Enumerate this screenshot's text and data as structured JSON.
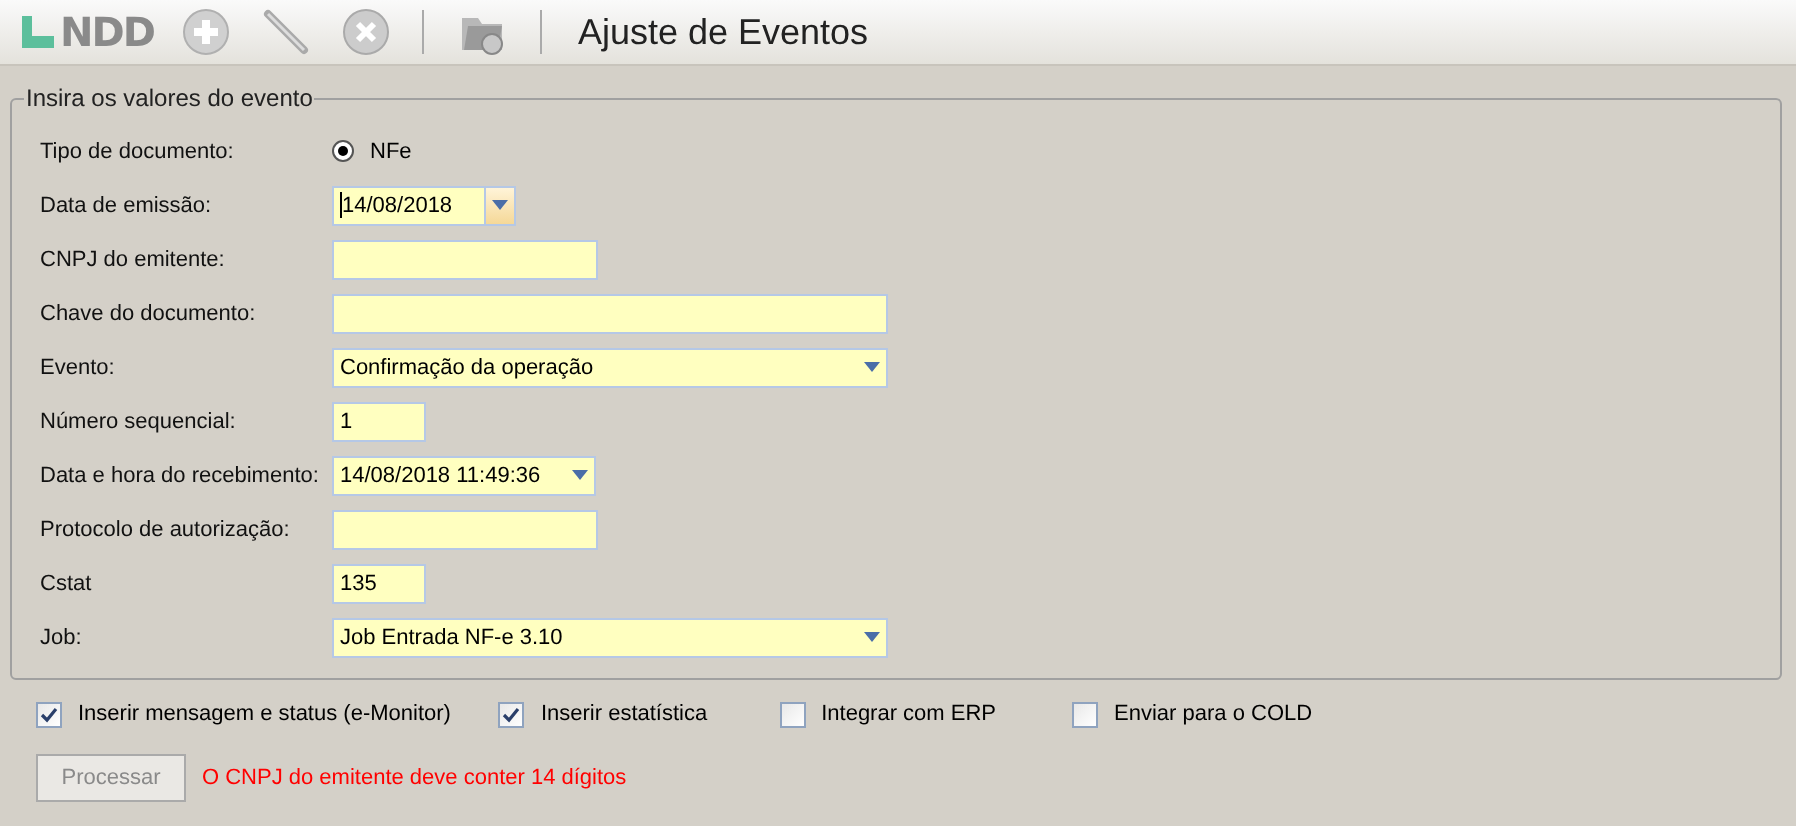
{
  "toolbar": {
    "logo": "NDD",
    "title": "Ajuste de Eventos",
    "tools": [
      {
        "kind": "add",
        "disabled": true
      },
      {
        "kind": "edit",
        "disabled": true
      },
      {
        "kind": "delete",
        "disabled": true
      },
      {
        "kind": "folder",
        "disabled": true
      }
    ]
  },
  "group": {
    "title": "Insira os valores do evento",
    "fields": [
      {
        "label": "Tipo de documento:",
        "kind": "radio",
        "option": "NFe",
        "selected": true
      },
      {
        "label": "Data de emissão:",
        "kind": "date",
        "value": "14/08/2018",
        "focused": true
      },
      {
        "label": "CNPJ do emitente:",
        "kind": "text"
      },
      {
        "label": "Chave do documento:",
        "kind": "text"
      },
      {
        "label": "Evento:",
        "kind": "combo",
        "value": "Confirmação da operação"
      },
      {
        "label": "Número sequencial:",
        "kind": "text",
        "value": "1"
      },
      {
        "label": "Data e hora do recebimento:",
        "kind": "date",
        "value": "14/08/2018 11:49:36",
        "focused": false
      },
      {
        "label": "Protocolo de autorização:",
        "kind": "text"
      },
      {
        "label": "Cstat",
        "kind": "text",
        "value": "135"
      },
      {
        "label": "Job:",
        "kind": "combo",
        "value": "Job Entrada NF-e 3.10"
      }
    ]
  },
  "options": [
    {
      "label": "Inserir mensagem e status (e-Monitor)",
      "checked": true
    },
    {
      "label": "Inserir estatística",
      "checked": true
    },
    {
      "label": "Integrar com ERP",
      "checked": false
    },
    {
      "label": "Enviar para o COLD",
      "checked": false
    }
  ],
  "process_button": {
    "label": "Processar",
    "disabled": true
  },
  "error": "O CNPJ do emitente deve conter 14 dígitos"
}
